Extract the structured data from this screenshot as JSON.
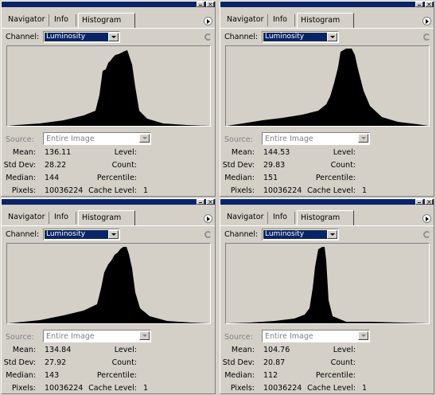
{
  "tabs": {
    "navigator": "Navigator",
    "info": "Info",
    "histogram": "Histogram"
  },
  "channel_label": "Channel:",
  "channel_value": "Luminosity",
  "source_label": "Source:",
  "source_value": "Entire Image",
  "labels": {
    "mean": "Mean:",
    "std_dev": "Std Dev:",
    "median": "Median:",
    "pixels": "Pixels:",
    "level": "Level:",
    "count": "Count:",
    "percentile": "Percentile:",
    "cache_level": "Cache Level:"
  },
  "icons": [
    "minimize-icon",
    "close-icon",
    "palette-menu-icon",
    "dropdown-arrow-icon",
    "refresh-icon"
  ],
  "panels": [
    {
      "mean": "136.11",
      "std_dev": "28.22",
      "median": "144",
      "pixels": "10036224",
      "cache_level": "1"
    },
    {
      "mean": "144.53",
      "std_dev": "29.83",
      "median": "151",
      "pixels": "10036224",
      "cache_level": "1"
    },
    {
      "mean": "134.84",
      "std_dev": "27.92",
      "median": "143",
      "pixels": "10036224",
      "cache_level": "1"
    },
    {
      "mean": "104.76",
      "std_dev": "20.87",
      "median": "112",
      "pixels": "10036224",
      "cache_level": "1"
    }
  ]
}
